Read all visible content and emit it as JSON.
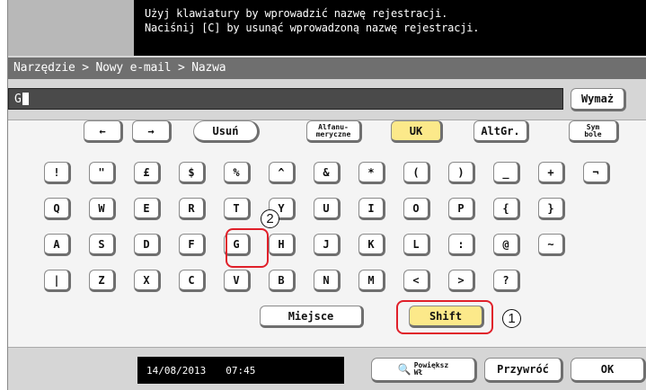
{
  "message": {
    "line1": "Użyj klawiatury by wprowadzić nazwę rejestracji.",
    "line2": "Naciśnij [C] by usunąć wprowadzoną nazwę rejestracji."
  },
  "breadcrumb": "Narzędzie > Nowy e-mail > Nazwa",
  "input": {
    "value": "G",
    "clear_label": "Wymaż"
  },
  "keys": {
    "arrow_left": "←",
    "arrow_right": "→",
    "delete": "Usuń",
    "alnum": "Alfanu-\nmeryczne",
    "uk": "UK",
    "altgr": "AltGr.",
    "symbols": "Sym\nbole",
    "row1": [
      "!",
      "\"",
      "£",
      "$",
      "%",
      "^",
      "&",
      "*",
      "(",
      ")",
      "_",
      "+",
      "¬"
    ],
    "row2": [
      "Q",
      "W",
      "E",
      "R",
      "T",
      "Y",
      "U",
      "I",
      "O",
      "P",
      "{",
      "}"
    ],
    "row3": [
      "A",
      "S",
      "D",
      "F",
      "G",
      "H",
      "J",
      "K",
      "L",
      ":",
      "@",
      "~"
    ],
    "row4": [
      "|",
      "Z",
      "X",
      "C",
      "V",
      "B",
      "N",
      "M",
      "<",
      ">",
      "?"
    ],
    "space": "Miejsce",
    "shift": "Shift"
  },
  "callouts": {
    "one": "1",
    "two": "2"
  },
  "status": {
    "date": "14/08/2013",
    "time": "07:45",
    "zoom_label": "Powiększ",
    "zoom_sub": "Wł",
    "restore": "Przywróć",
    "ok": "OK"
  }
}
